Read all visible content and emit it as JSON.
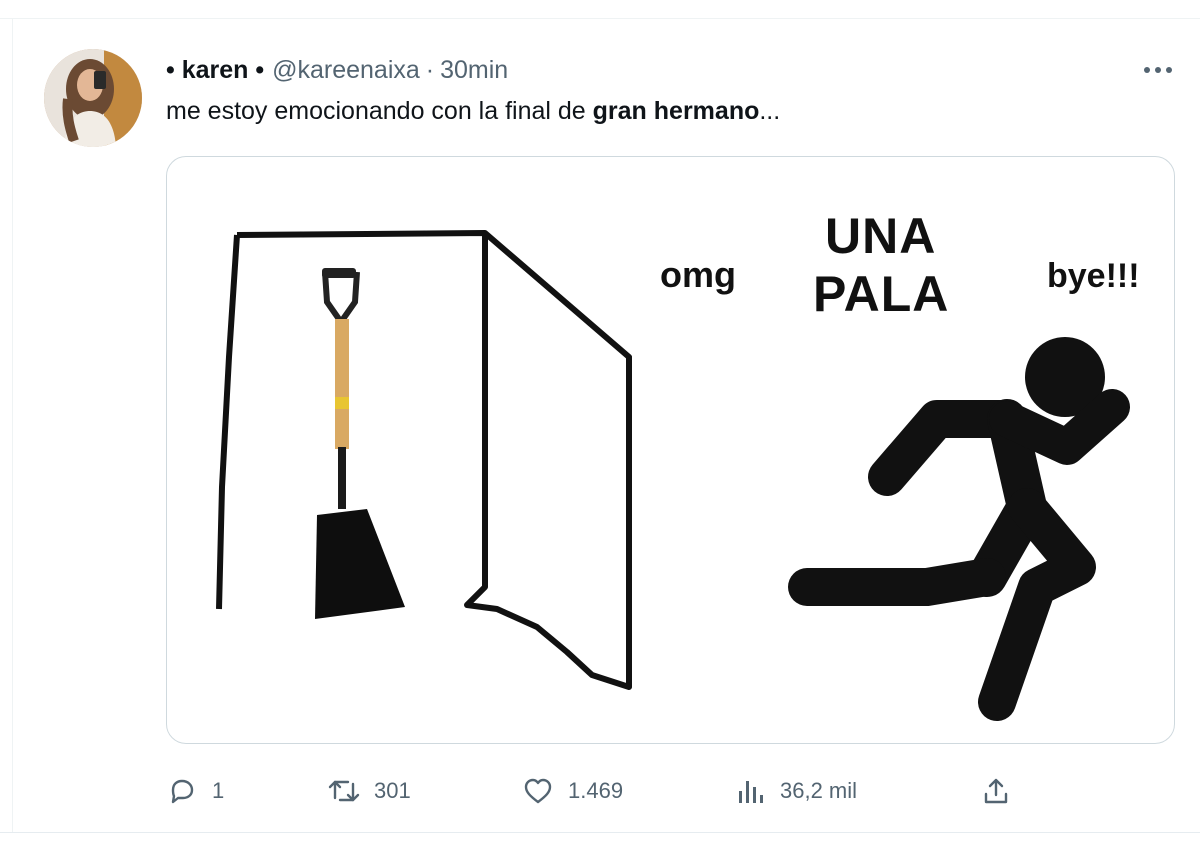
{
  "tweet": {
    "author": {
      "display_name": "• karen •",
      "handle": "@kareenaixa",
      "separator": "·",
      "time": "30min"
    },
    "text": {
      "prefix": "me estoy emocionando con la final de ",
      "bold": "gran hermano",
      "suffix": "..."
    },
    "media": {
      "meme_omg": "omg",
      "meme_una": "UNA",
      "meme_pala": "PALA",
      "meme_bye": "bye!!!"
    },
    "actions": {
      "replies": "1",
      "retweets": "301",
      "likes": "1.469",
      "views": "36,2 mil"
    }
  },
  "icons": {
    "more": "more-horizontal-icon",
    "reply": "reply-icon",
    "retweet": "retweet-icon",
    "like": "heart-icon",
    "views": "views-chart-icon",
    "share": "share-icon"
  },
  "colors": {
    "text_primary": "#0f1419",
    "text_secondary": "#536471",
    "border": "#cfd9de"
  }
}
